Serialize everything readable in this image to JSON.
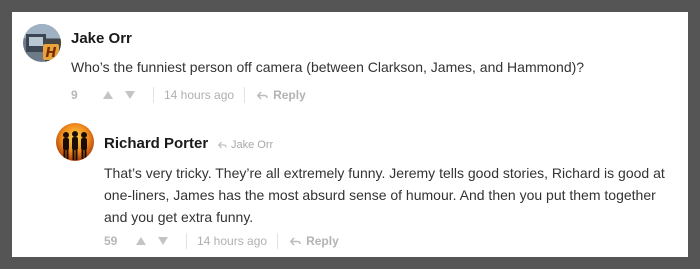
{
  "comments": [
    {
      "author": "Jake Orr",
      "text": "Who’s the funniest person off camera (between Clarkson, James, and Hammond)?",
      "votes": "9",
      "time": "14 hours ago",
      "reply_label": "Reply",
      "avatar_badge": "H"
    },
    {
      "author": "Richard Porter",
      "reply_to": "Jake Orr",
      "text": "That’s very tricky. They’re all extremely funny. Jeremy tells good stories, Richard is good at one-liners, James has the most absurd sense of humour. And then you put them together and you get extra funny.",
      "votes": "59",
      "time": "14 hours ago",
      "reply_label": "Reply"
    }
  ],
  "colors": {
    "background": "#555555",
    "card": "#ffffff",
    "meta_text": "#b3b3b3",
    "author_text": "#1a1a1a",
    "body_text": "#333333"
  }
}
